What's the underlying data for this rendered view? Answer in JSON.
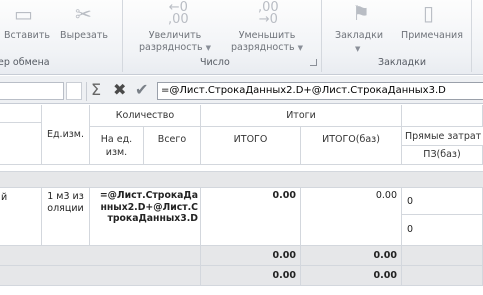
{
  "ribbon": {
    "paste_label": "Вставить",
    "cut_label": "Вырезать",
    "increase_precision_line1": "Увеличить",
    "increase_precision_line2": "разрядность",
    "decrease_precision_line1": "Уменьшить",
    "decrease_precision_line2": "разрядность",
    "bookmarks_label": "Закладки",
    "notes_label": "Примечания",
    "group_clipboard": "ер обмена",
    "group_number": "Число",
    "group_bookmarks": "Закладки"
  },
  "formula_bar": {
    "name_box": "",
    "formula": "=@Лист.СтрокаДанных2.D+@Лист.СтрокаДанных3.D"
  },
  "table": {
    "headers": {
      "unit": "Ед.изм.",
      "quantity": "Количество",
      "qty_per_unit": "На ед. изм.",
      "qty_total": "Всего",
      "totals": "Итоги",
      "total": "ИТОГО",
      "total_base": "ИТОГО(баз)",
      "direct_costs": "Прямые затрат",
      "pz_base": "ПЗ(баз)"
    },
    "row1": {
      "name_tail": "й",
      "unit": "1 м3 изоляции",
      "total_formula": "=@Лист.СтрокаДанных2.D+@Лист.СтрокаДанных3.D",
      "total": "0.00",
      "total_base": "0.00",
      "direct_a": "0",
      "direct_b": "0"
    },
    "row2": {
      "total": "0.00",
      "total_base": "0.00"
    },
    "row3": {
      "total": "0.00",
      "total_base": "0.00"
    }
  }
}
